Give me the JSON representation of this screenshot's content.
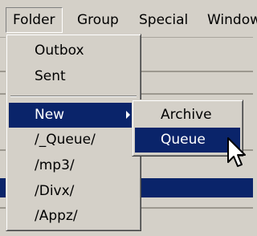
{
  "menubar": {
    "items": [
      "Folder",
      "Group",
      "Special",
      "Window"
    ]
  },
  "folder_menu": {
    "items": [
      "Outbox",
      "Sent",
      "New",
      "/_Queue/",
      "/mp3/",
      "/Divx/",
      "/Appz/"
    ]
  },
  "new_submenu": {
    "items": [
      "Archive",
      "Queue"
    ]
  },
  "icons": {
    "submenu_arrow": "chevron-right-icon",
    "cursor": "arrow-cursor-icon"
  },
  "colors": {
    "highlight": "#0a246a",
    "face": "#d4d0c8",
    "highlight_text": "#ffffff"
  }
}
